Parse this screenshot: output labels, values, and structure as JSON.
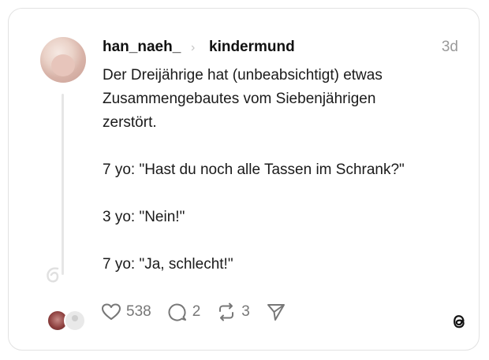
{
  "post": {
    "username": "han_naeh_",
    "separator": "›",
    "community": "kindermund",
    "time": "3d",
    "lines": {
      "l1": "Der Dreijährige hat (unbeabsichtigt) etwas",
      "l2": "Zusammengebautes vom Siebenjährigen",
      "l3": "zerstört.",
      "l4": "7 yo: \"Hast du noch alle Tassen im Schrank?\"",
      "l5": "3 yo: \"Nein!\"",
      "l6": "7 yo: \"Ja, schlecht!\""
    }
  },
  "actions": {
    "likes": "538",
    "comments": "2",
    "reposts": "3"
  },
  "icons": {
    "like": "heart-icon",
    "comment": "comment-icon",
    "repost": "repost-icon",
    "share": "send-icon",
    "brand": "threads-logo-icon"
  },
  "colors": {
    "text": "#1a1a1a",
    "muted": "#777777",
    "border": "#e2e2e2"
  }
}
